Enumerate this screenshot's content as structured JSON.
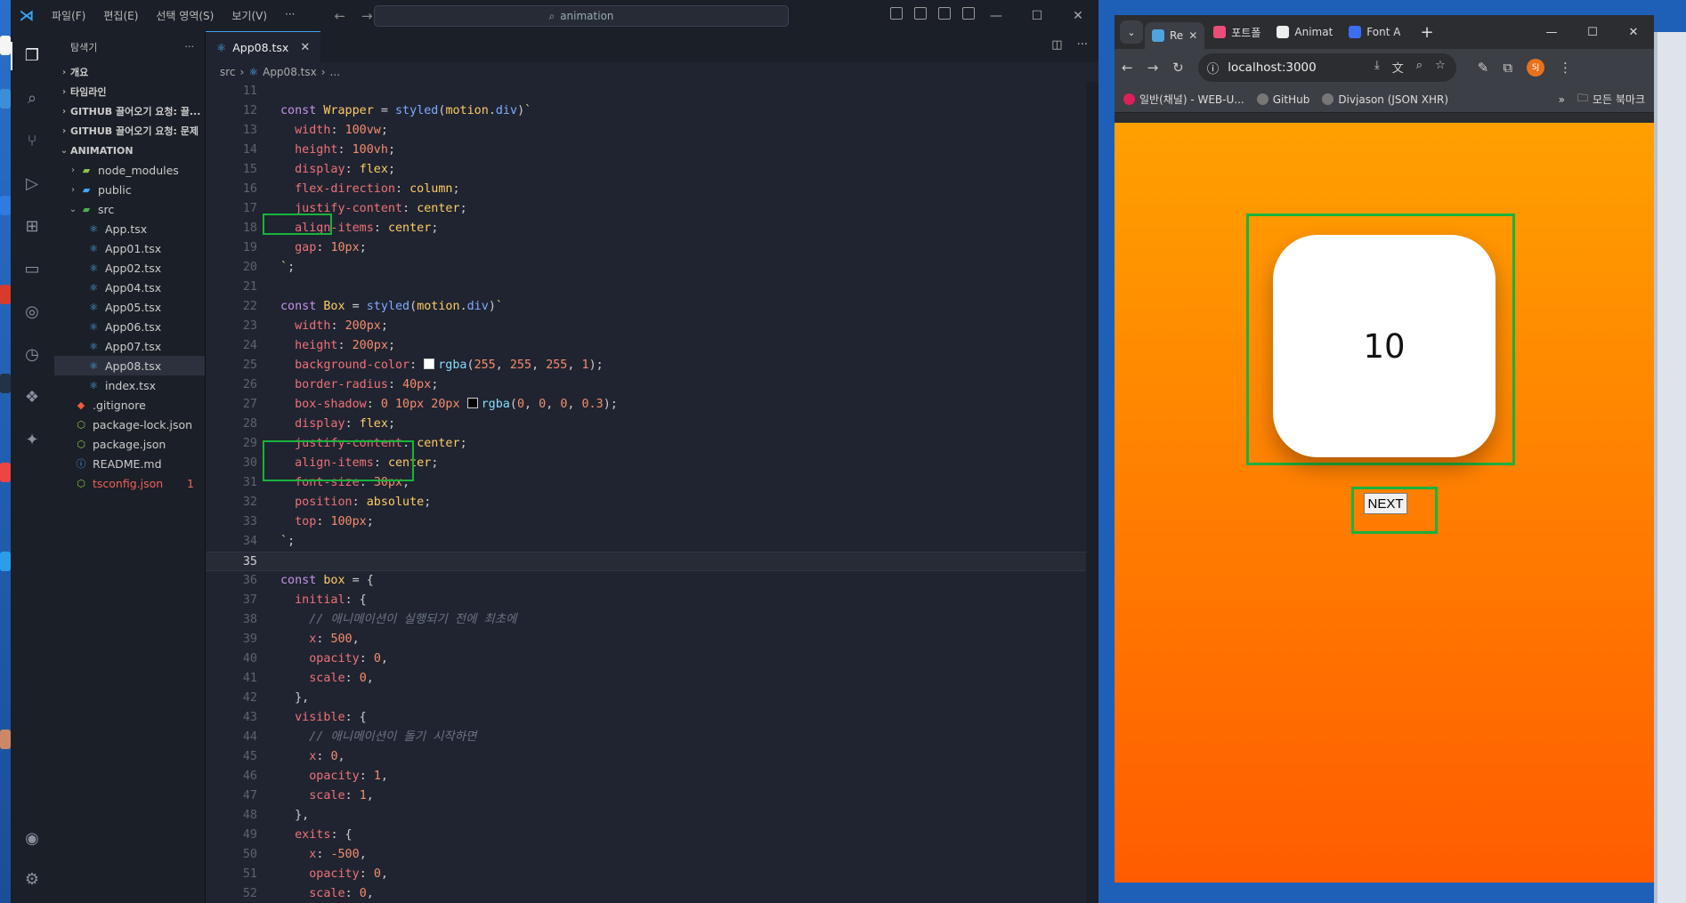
{
  "vscode": {
    "menus": [
      "파일(F)",
      "편집(E)",
      "선택 영역(S)",
      "보기(V)",
      "···"
    ],
    "search": "animation",
    "explorer_title": "탐색기",
    "sections": [
      {
        "label": "개요"
      },
      {
        "label": "타임라인"
      },
      {
        "label": "GITHUB 끌어오기 요청: 끌..."
      },
      {
        "label": "GITHUB 끌어오기 요청: 문제"
      },
      {
        "label": "ANIMATION"
      }
    ],
    "files": [
      {
        "label": "node_modules",
        "icon": "folder-node-icon"
      },
      {
        "label": "public",
        "icon": "folder-public-icon"
      },
      {
        "label": "src",
        "icon": "folder-src-icon"
      },
      {
        "label": "App.tsx"
      },
      {
        "label": "App01.tsx"
      },
      {
        "label": "App02.tsx"
      },
      {
        "label": "App04.tsx"
      },
      {
        "label": "App05.tsx"
      },
      {
        "label": "App06.tsx"
      },
      {
        "label": "App07.tsx"
      },
      {
        "label": "App08.tsx"
      },
      {
        "label": "index.tsx"
      },
      {
        "label": ".gitignore"
      },
      {
        "label": "package-lock.json"
      },
      {
        "label": "package.json"
      },
      {
        "label": "README.md"
      },
      {
        "label": "tsconfig.json",
        "badge": "1"
      }
    ],
    "active_tab": "App08.tsx",
    "breadcrumb": [
      "src",
      "App08.tsx",
      "..."
    ],
    "current_line": 35,
    "code": [
      [],
      [
        [
          "k",
          "const "
        ],
        [
          "v",
          "Wrapper"
        ],
        [
          "pl",
          " = "
        ],
        [
          "f",
          "styled"
        ],
        [
          "pl",
          "("
        ],
        [
          "v",
          "motion"
        ],
        [
          "pl",
          "."
        ],
        [
          "f",
          "div"
        ],
        [
          "pl",
          ")"
        ],
        [
          "s",
          "`"
        ]
      ],
      [
        [
          "pl",
          "  "
        ],
        [
          "p",
          "width"
        ],
        [
          "pl",
          ": "
        ],
        [
          "n",
          "100vw"
        ],
        [
          "pl",
          ";"
        ]
      ],
      [
        [
          "pl",
          "  "
        ],
        [
          "p",
          "height"
        ],
        [
          "pl",
          ": "
        ],
        [
          "n",
          "100vh"
        ],
        [
          "pl",
          ";"
        ]
      ],
      [
        [
          "pl",
          "  "
        ],
        [
          "p",
          "display"
        ],
        [
          "pl",
          ": "
        ],
        [
          "v",
          "flex"
        ],
        [
          "pl",
          ";"
        ]
      ],
      [
        [
          "pl",
          "  "
        ],
        [
          "p",
          "flex-direction"
        ],
        [
          "pl",
          ": "
        ],
        [
          "v",
          "column"
        ],
        [
          "pl",
          ";"
        ]
      ],
      [
        [
          "pl",
          "  "
        ],
        [
          "p",
          "justify-content"
        ],
        [
          "pl",
          ": "
        ],
        [
          "v",
          "center"
        ],
        [
          "pl",
          ";"
        ]
      ],
      [
        [
          "pl",
          "  "
        ],
        [
          "p",
          "align-items"
        ],
        [
          "pl",
          ": "
        ],
        [
          "v",
          "center"
        ],
        [
          "pl",
          ";"
        ]
      ],
      [
        [
          "pl",
          "  "
        ],
        [
          "p",
          "gap"
        ],
        [
          "pl",
          ": "
        ],
        [
          "n",
          "10px"
        ],
        [
          "pl",
          ";"
        ]
      ],
      [
        [
          "s",
          "`"
        ],
        [
          "pl",
          ";"
        ]
      ],
      [],
      [
        [
          "k",
          "const "
        ],
        [
          "v",
          "Box"
        ],
        [
          "pl",
          " = "
        ],
        [
          "f",
          "styled"
        ],
        [
          "pl",
          "("
        ],
        [
          "v",
          "motion"
        ],
        [
          "pl",
          "."
        ],
        [
          "f",
          "div"
        ],
        [
          "pl",
          ")"
        ],
        [
          "s",
          "`"
        ]
      ],
      [
        [
          "pl",
          "  "
        ],
        [
          "p",
          "width"
        ],
        [
          "pl",
          ": "
        ],
        [
          "n",
          "200px"
        ],
        [
          "pl",
          ";"
        ]
      ],
      [
        [
          "pl",
          "  "
        ],
        [
          "p",
          "height"
        ],
        [
          "pl",
          ": "
        ],
        [
          "n",
          "200px"
        ],
        [
          "pl",
          ";"
        ]
      ],
      [
        [
          "pl",
          "  "
        ],
        [
          "p",
          "background-color"
        ],
        [
          "pl",
          ": "
        ],
        [
          "sw",
          "#ffffff"
        ],
        [
          "tp",
          "rgba"
        ],
        [
          "pl",
          "("
        ],
        [
          "n",
          "255"
        ],
        [
          "pl",
          ", "
        ],
        [
          "n",
          "255"
        ],
        [
          "pl",
          ", "
        ],
        [
          "n",
          "255"
        ],
        [
          "pl",
          ", "
        ],
        [
          "n",
          "1"
        ],
        [
          "pl",
          ");"
        ]
      ],
      [
        [
          "pl",
          "  "
        ],
        [
          "p",
          "border-radius"
        ],
        [
          "pl",
          ": "
        ],
        [
          "n",
          "40px"
        ],
        [
          "pl",
          ";"
        ]
      ],
      [
        [
          "pl",
          "  "
        ],
        [
          "p",
          "box-shadow"
        ],
        [
          "pl",
          ": "
        ],
        [
          "n",
          "0 10px 20px "
        ],
        [
          "sw",
          "#000000"
        ],
        [
          "tp",
          "rgba"
        ],
        [
          "pl",
          "("
        ],
        [
          "n",
          "0"
        ],
        [
          "pl",
          ", "
        ],
        [
          "n",
          "0"
        ],
        [
          "pl",
          ", "
        ],
        [
          "n",
          "0"
        ],
        [
          "pl",
          ", "
        ],
        [
          "n",
          "0.3"
        ],
        [
          "pl",
          ");"
        ]
      ],
      [
        [
          "pl",
          "  "
        ],
        [
          "p",
          "display"
        ],
        [
          "pl",
          ": "
        ],
        [
          "v",
          "flex"
        ],
        [
          "pl",
          ";"
        ]
      ],
      [
        [
          "pl",
          "  "
        ],
        [
          "p",
          "justify-content"
        ],
        [
          "pl",
          ": "
        ],
        [
          "v",
          "center"
        ],
        [
          "pl",
          ";"
        ]
      ],
      [
        [
          "pl",
          "  "
        ],
        [
          "p",
          "align-items"
        ],
        [
          "pl",
          ": "
        ],
        [
          "v",
          "center"
        ],
        [
          "pl",
          ";"
        ]
      ],
      [
        [
          "pl",
          "  "
        ],
        [
          "p",
          "font-size"
        ],
        [
          "pl",
          ": "
        ],
        [
          "n",
          "30px"
        ],
        [
          "pl",
          ";"
        ]
      ],
      [
        [
          "pl",
          "  "
        ],
        [
          "p",
          "position"
        ],
        [
          "pl",
          ": "
        ],
        [
          "v",
          "absolute"
        ],
        [
          "pl",
          ";"
        ]
      ],
      [
        [
          "pl",
          "  "
        ],
        [
          "p",
          "top"
        ],
        [
          "pl",
          ": "
        ],
        [
          "n",
          "100px"
        ],
        [
          "pl",
          ";"
        ]
      ],
      [
        [
          "s",
          "`"
        ],
        [
          "pl",
          ";"
        ]
      ],
      [],
      [
        [
          "k",
          "const "
        ],
        [
          "v",
          "box"
        ],
        [
          "pl",
          " = {"
        ]
      ],
      [
        [
          "pl",
          "  "
        ],
        [
          "p",
          "initial"
        ],
        [
          "pl",
          ": {"
        ]
      ],
      [
        [
          "pl",
          "    "
        ],
        [
          "c",
          "// 애니메이션이 실행되기 전에 최초에"
        ]
      ],
      [
        [
          "pl",
          "    "
        ],
        [
          "p",
          "x"
        ],
        [
          "pl",
          ": "
        ],
        [
          "n",
          "500"
        ],
        [
          "pl",
          ","
        ]
      ],
      [
        [
          "pl",
          "    "
        ],
        [
          "p",
          "opacity"
        ],
        [
          "pl",
          ": "
        ],
        [
          "n",
          "0"
        ],
        [
          "pl",
          ","
        ]
      ],
      [
        [
          "pl",
          "    "
        ],
        [
          "p",
          "scale"
        ],
        [
          "pl",
          ": "
        ],
        [
          "n",
          "0"
        ],
        [
          "pl",
          ","
        ]
      ],
      [
        [
          "pl",
          "  },"
        ]
      ],
      [
        [
          "pl",
          "  "
        ],
        [
          "p",
          "visible"
        ],
        [
          "pl",
          ": {"
        ]
      ],
      [
        [
          "pl",
          "    "
        ],
        [
          "c",
          "// 애니메이션이 돌기 시작하면"
        ]
      ],
      [
        [
          "pl",
          "    "
        ],
        [
          "p",
          "x"
        ],
        [
          "pl",
          ": "
        ],
        [
          "n",
          "0"
        ],
        [
          "pl",
          ","
        ]
      ],
      [
        [
          "pl",
          "    "
        ],
        [
          "p",
          "opacity"
        ],
        [
          "pl",
          ": "
        ],
        [
          "n",
          "1"
        ],
        [
          "pl",
          ","
        ]
      ],
      [
        [
          "pl",
          "    "
        ],
        [
          "p",
          "scale"
        ],
        [
          "pl",
          ": "
        ],
        [
          "n",
          "1"
        ],
        [
          "pl",
          ","
        ]
      ],
      [
        [
          "pl",
          "  },"
        ]
      ],
      [
        [
          "pl",
          "  "
        ],
        [
          "p",
          "exits"
        ],
        [
          "pl",
          ": {"
        ]
      ],
      [
        [
          "pl",
          "    "
        ],
        [
          "p",
          "x"
        ],
        [
          "pl",
          ": "
        ],
        [
          "n",
          "-500"
        ],
        [
          "pl",
          ","
        ]
      ],
      [
        [
          "pl",
          "    "
        ],
        [
          "p",
          "opacity"
        ],
        [
          "pl",
          ": "
        ],
        [
          "n",
          "0"
        ],
        [
          "pl",
          ","
        ]
      ],
      [
        [
          "pl",
          "    "
        ],
        [
          "p",
          "scale"
        ],
        [
          "pl",
          ": "
        ],
        [
          "n",
          "0"
        ],
        [
          "pl",
          ","
        ]
      ]
    ],
    "first_line_number": 11
  },
  "chrome": {
    "tabs": [
      {
        "title": "Re",
        "color": "#4fa3e0"
      },
      {
        "title": "포트폴",
        "color": "#e94e77"
      },
      {
        "title": "Animat",
        "color": "#eeeeee"
      },
      {
        "title": "Font A",
        "color": "#3a6ff0"
      }
    ],
    "url": "localhost:3000",
    "avatar": "SJ",
    "bookmarks": [
      "일반(채널) - WEB-U...",
      "GitHub",
      "Divjason (JSON XHR)"
    ],
    "bookmarks_more": "»",
    "all_bookmarks": "모든 북마크",
    "page": {
      "counter": "10",
      "next_label": "NEXT",
      "gradient": [
        "#ffa000",
        "#ff5c00"
      ]
    }
  }
}
